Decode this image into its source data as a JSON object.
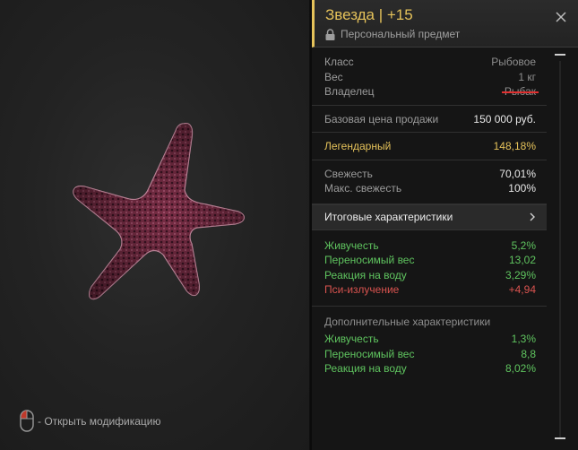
{
  "item": {
    "title": "Звезда | +15",
    "subtitle": "Персональный предмет",
    "accent_color": "#e5c25a"
  },
  "basic": [
    {
      "label": "Класс",
      "value": "Рыбовое"
    },
    {
      "label": "Вес",
      "value": "1 кг"
    },
    {
      "label": "Владелец",
      "value": "Рыбак"
    }
  ],
  "price": {
    "label": "Базовая цена продажи",
    "value": "150 000 руб."
  },
  "rarity": {
    "label": "Легендарный",
    "value": "148,18%"
  },
  "freshness": [
    {
      "label": "Свежесть",
      "value": "70,01%"
    },
    {
      "label": "Макс. свежесть",
      "value": "100%"
    }
  ],
  "totals": {
    "label": "Итоговые характеристики",
    "icon": "chevron-right-icon"
  },
  "stats": [
    {
      "label": "Живучесть",
      "value": "5,2%"
    },
    {
      "label": "Переносимый вес",
      "value": "13,02"
    },
    {
      "label": "Реакция на воду",
      "value": "3,29%"
    },
    {
      "label": "Пси-излучение",
      "value": "+4,94"
    }
  ],
  "extra": {
    "header": "Дополнительные характеристики",
    "rows": [
      {
        "label": "Живучесть",
        "value": "1,3%"
      },
      {
        "label": "Переносимый вес",
        "value": "8,8"
      },
      {
        "label": "Реакция на воду",
        "value": "8,02%"
      }
    ]
  },
  "hint": {
    "text": "- Открыть модификацию",
    "icon": "mouse-icon"
  }
}
